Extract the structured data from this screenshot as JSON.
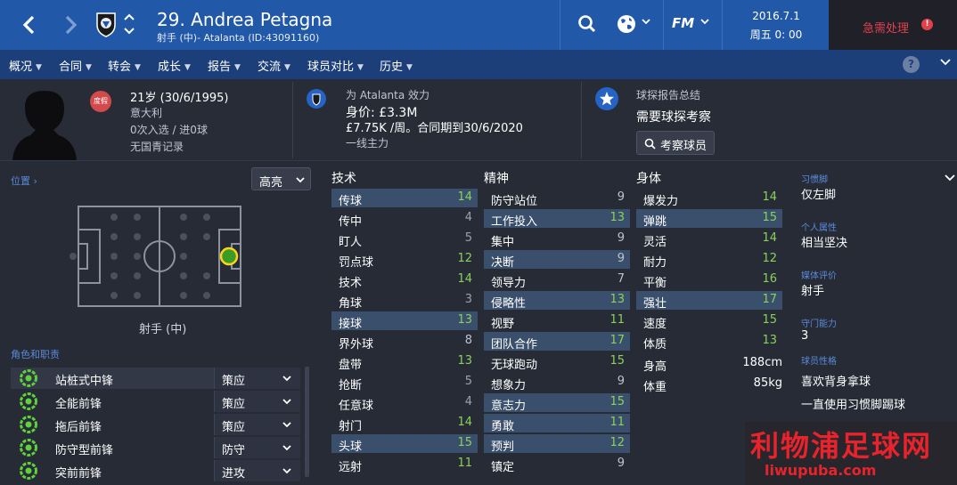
{
  "header": {
    "player_name": "29. Andrea Petagna",
    "player_sub": "射手 (中)- Atalanta (ID:43091160)",
    "brand": "FM",
    "date": "2016.7.1",
    "time": "周五 0: 00",
    "urgent": "急需处理"
  },
  "menu": [
    "概况",
    "合同",
    "转会",
    "成长",
    "报告",
    "交流",
    "球员对比",
    "历史"
  ],
  "menu_help": "?",
  "info": {
    "injury_badge": "度假",
    "age": "21岁 (30/6/1995)",
    "nation": "意大利",
    "caps": "0次入选 / 进0球",
    "youth": "无国青记录",
    "club_line": "为 Atalanta 效力",
    "value": "身价: £3.3M",
    "wage": "£7.75K /周。合同期到30/6/2020",
    "squad": "一线主力",
    "scout_title": "球探报告总结",
    "scout_text": "需要球探考察",
    "scout_button": "考察球员"
  },
  "position": {
    "title": "位置",
    "highlight": "高亮",
    "label": "射手 (中)"
  },
  "roles": {
    "title": "角色和职责",
    "items": [
      {
        "name": "站桩式中锋",
        "duty": "策应"
      },
      {
        "name": "全能前锋",
        "duty": "策应"
      },
      {
        "name": "拖后前锋",
        "duty": "策应"
      },
      {
        "name": "防守型前锋",
        "duty": "防守"
      },
      {
        "name": "突前前锋",
        "duty": "进攻"
      }
    ]
  },
  "attributes": {
    "technical": {
      "title": "技术",
      "items": [
        {
          "name": "传球",
          "value": 14
        },
        {
          "name": "传中",
          "value": 4
        },
        {
          "name": "盯人",
          "value": 5
        },
        {
          "name": "罚点球",
          "value": 12
        },
        {
          "name": "技术",
          "value": 14
        },
        {
          "name": "角球",
          "value": 3
        },
        {
          "name": "接球",
          "value": 13
        },
        {
          "name": "界外球",
          "value": 8
        },
        {
          "name": "盘带",
          "value": 13
        },
        {
          "name": "抢断",
          "value": 5
        },
        {
          "name": "任意球",
          "value": 4
        },
        {
          "name": "射门",
          "value": 14
        },
        {
          "name": "头球",
          "value": 15
        },
        {
          "name": "远射",
          "value": 11
        }
      ]
    },
    "mental": {
      "title": "精神",
      "items": [
        {
          "name": "防守站位",
          "value": 9
        },
        {
          "name": "工作投入",
          "value": 13
        },
        {
          "name": "集中",
          "value": 9
        },
        {
          "name": "决断",
          "value": 9
        },
        {
          "name": "领导力",
          "value": 7
        },
        {
          "name": "侵略性",
          "value": 13
        },
        {
          "name": "视野",
          "value": 11
        },
        {
          "name": "团队合作",
          "value": 17
        },
        {
          "name": "无球跑动",
          "value": 15
        },
        {
          "name": "想象力",
          "value": 9
        },
        {
          "name": "意志力",
          "value": 15
        },
        {
          "name": "勇敢",
          "value": 11
        },
        {
          "name": "预判",
          "value": 12
        },
        {
          "name": "镇定",
          "value": 9
        }
      ]
    },
    "physical": {
      "title": "身体",
      "items": [
        {
          "name": "爆发力",
          "value": 14
        },
        {
          "name": "弹跳",
          "value": 15
        },
        {
          "name": "灵活",
          "value": 14
        },
        {
          "name": "耐力",
          "value": 12
        },
        {
          "name": "平衡",
          "value": 16
        },
        {
          "name": "强壮",
          "value": 17
        },
        {
          "name": "速度",
          "value": 15
        },
        {
          "name": "体质",
          "value": 13
        }
      ],
      "height_label": "身高",
      "height": "188cm",
      "weight_label": "体重",
      "weight": "85kg"
    }
  },
  "side": {
    "foot_title": "习惯脚",
    "foot": "仅左脚",
    "personality_title": "个人属性",
    "personality": "相当坚决",
    "media_title": "媒体评价",
    "media": "射手",
    "gk_title": "守门能力",
    "gk": "3",
    "traits_title": "球员性格",
    "traits": [
      "喜欢背身拿球",
      "一直使用习惯脚踢球"
    ]
  },
  "watermark": {
    "title": "利物浦足球网",
    "url": "liwupuba.com"
  },
  "colors": {
    "topbar": "#2158a8",
    "menubar": "#1c3f7a",
    "background": "#262b36",
    "highlight_row": "#394f6c",
    "value_green": "#8bd15a",
    "urgent": "#e0414b"
  }
}
